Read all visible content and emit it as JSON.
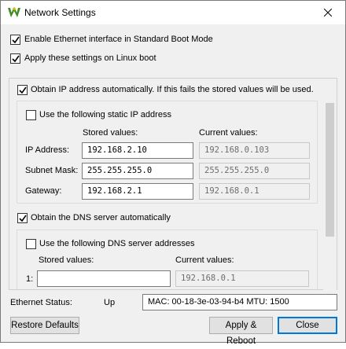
{
  "window": {
    "title": "Network Settings",
    "close_icon": "close-icon",
    "app_icon": "app-logo-icon"
  },
  "options": {
    "enable_ethernet": {
      "label": "Enable Ethernet interface in Standard Boot Mode",
      "checked": true
    },
    "apply_linux": {
      "label": "Apply these settings on Linux boot",
      "checked": true
    },
    "obtain_ip_auto": {
      "label": "Obtain IP address automatically. If this fails the stored values will be used.",
      "checked": true
    },
    "static_ip": {
      "label": "Use the following static IP address",
      "checked": false
    },
    "obtain_dns_auto": {
      "label": "Obtain the DNS server automatically",
      "checked": true
    },
    "dns_manual": {
      "label": "Use the following DNS server addresses",
      "checked": false
    }
  },
  "ip_table": {
    "stored_header": "Stored values:",
    "current_header": "Current values:",
    "rows": [
      {
        "label": "IP Address:",
        "stored": "192.168.2.10",
        "current": "192.168.0.103"
      },
      {
        "label": "Subnet Mask:",
        "stored": "255.255.255.0",
        "current": "255.255.255.0"
      },
      {
        "label": "Gateway:",
        "stored": "192.168.2.1",
        "current": "192.168.0.1"
      }
    ]
  },
  "dns_table": {
    "stored_header": "Stored values:",
    "current_header": "Current values:",
    "rows": [
      {
        "label": "1:",
        "stored": "",
        "current": "192.168.0.1"
      }
    ]
  },
  "status": {
    "label": "Ethernet Status:",
    "value": "Up",
    "mac_info": "MAC: 00-18-3e-03-94-b4 MTU: 1500"
  },
  "buttons": {
    "restore": "Restore Defaults",
    "apply_reboot": "Apply & Reboot",
    "close": "Close"
  },
  "colors": {
    "accent": "#0078d7",
    "logo_green": "#3c8c1e",
    "logo_yellow": "#e8b400"
  }
}
